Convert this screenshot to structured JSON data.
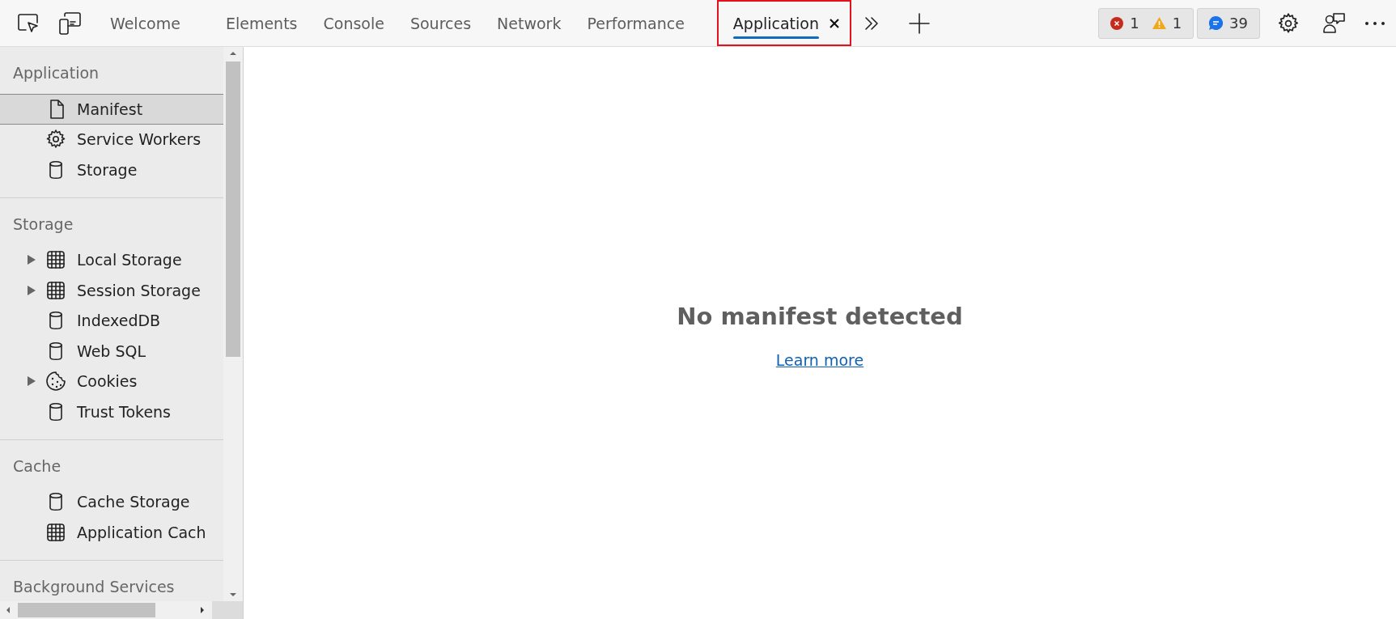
{
  "toolbar": {
    "tabs": [
      {
        "label": "Welcome",
        "selected": false,
        "highlighted": false
      },
      {
        "label": "Elements",
        "selected": false,
        "highlighted": false
      },
      {
        "label": "Console",
        "selected": false,
        "highlighted": false
      },
      {
        "label": "Sources",
        "selected": false,
        "highlighted": false
      },
      {
        "label": "Network",
        "selected": false,
        "highlighted": false
      },
      {
        "label": "Performance",
        "selected": false,
        "highlighted": false
      },
      {
        "label": "Application",
        "selected": true,
        "highlighted": true
      }
    ],
    "errors": "1",
    "warnings": "1",
    "messages": "39"
  },
  "sidebar": {
    "sections": [
      {
        "title": "Application",
        "items": [
          {
            "label": "Manifest",
            "kind": "file",
            "has_children": false,
            "selected": true
          },
          {
            "label": "Service Workers",
            "kind": "gear",
            "has_children": false,
            "selected": false
          },
          {
            "label": "Storage",
            "kind": "database",
            "has_children": false,
            "selected": false
          }
        ]
      },
      {
        "title": "Storage",
        "items": [
          {
            "label": "Local Storage",
            "kind": "grid",
            "has_children": true,
            "selected": false
          },
          {
            "label": "Session Storage",
            "kind": "grid",
            "has_children": true,
            "selected": false
          },
          {
            "label": "IndexedDB",
            "kind": "database",
            "has_children": false,
            "selected": false
          },
          {
            "label": "Web SQL",
            "kind": "database",
            "has_children": false,
            "selected": false
          },
          {
            "label": "Cookies",
            "kind": "cookie",
            "has_children": true,
            "selected": false
          },
          {
            "label": "Trust Tokens",
            "kind": "database",
            "has_children": false,
            "selected": false
          }
        ]
      },
      {
        "title": "Cache",
        "items": [
          {
            "label": "Cache Storage",
            "kind": "database",
            "has_children": false,
            "selected": false
          },
          {
            "label": "Application Cach",
            "kind": "grid",
            "has_children": false,
            "selected": false
          }
        ]
      },
      {
        "title": "Background Services"
      }
    ]
  },
  "main": {
    "message": "No manifest detected",
    "link": "Learn more"
  }
}
